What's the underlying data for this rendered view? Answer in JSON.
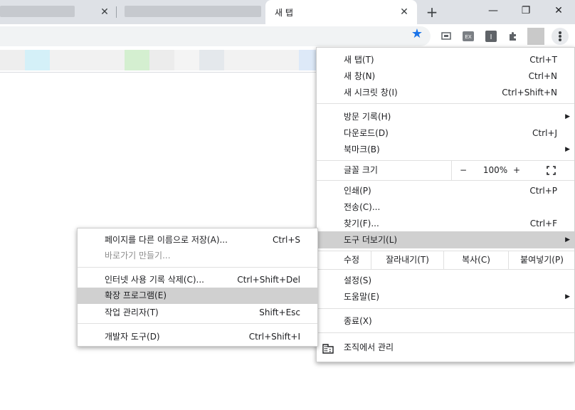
{
  "tabs": [
    {
      "title": "",
      "blurred": true
    },
    {
      "title": "",
      "blurred": true
    },
    {
      "title": "새 탭",
      "active": true
    }
  ],
  "window": {
    "new_tab": "+",
    "minimize": "—",
    "restore": "❐",
    "close": "✕"
  },
  "toolbar": {
    "bookmark_star": "★",
    "extensions": [
      "ext-screen-icon",
      "ext-ex-icon",
      "ext-info-icon",
      "extensions-puzzle-icon"
    ],
    "ex_label": "EX",
    "info_label": "I"
  },
  "main_menu": {
    "items": [
      {
        "label": "새 탭(T)",
        "shortcut": "Ctrl+T"
      },
      {
        "label": "새 창(N)",
        "shortcut": "Ctrl+N"
      },
      {
        "label": "새 시크릿 창(I)",
        "shortcut": "Ctrl+Shift+N"
      },
      {
        "label": "방문 기록(H)",
        "shortcut": "",
        "submenu": true
      },
      {
        "label": "다운로드(D)",
        "shortcut": "Ctrl+J"
      },
      {
        "label": "북마크(B)",
        "shortcut": "",
        "submenu": true
      },
      {
        "label": "인쇄(P)",
        "shortcut": "Ctrl+P"
      },
      {
        "label": "전송(C)...",
        "shortcut": ""
      },
      {
        "label": "찾기(F)...",
        "shortcut": "Ctrl+F"
      },
      {
        "label": "도구 더보기(L)",
        "shortcut": "",
        "submenu": true,
        "highlighted": true
      },
      {
        "label": "설정(S)",
        "shortcut": ""
      },
      {
        "label": "도움말(E)",
        "shortcut": "",
        "submenu": true
      },
      {
        "label": "종료(X)",
        "shortcut": ""
      },
      {
        "label": "조직에서 관리",
        "shortcut": ""
      }
    ],
    "zoom": {
      "label": "글꼴 크기",
      "minus": "−",
      "value": "100%",
      "plus": "+"
    },
    "edit": {
      "label": "수정",
      "cut": "잘라내기(T)",
      "copy": "복사(C)",
      "paste": "붙여넣기(P)"
    }
  },
  "submenu": {
    "items": [
      {
        "label": "페이지를 다른 이름으로 저장(A)...",
        "shortcut": "Ctrl+S"
      },
      {
        "label": "바로가기 만들기...",
        "shortcut": "",
        "disabled": true
      },
      {
        "label": "인터넷 사용 기록 삭제(C)...",
        "shortcut": "Ctrl+Shift+Del"
      },
      {
        "label": "확장 프로그램(E)",
        "shortcut": "",
        "highlighted": true
      },
      {
        "label": "작업 관리자(T)",
        "shortcut": "Shift+Esc"
      },
      {
        "label": "개발자 도구(D)",
        "shortcut": "Ctrl+Shift+I"
      }
    ]
  },
  "colors": {
    "accent": "#1a73e8",
    "highlight": "#d0d0d0",
    "tabstrip": "#dee1e6"
  }
}
